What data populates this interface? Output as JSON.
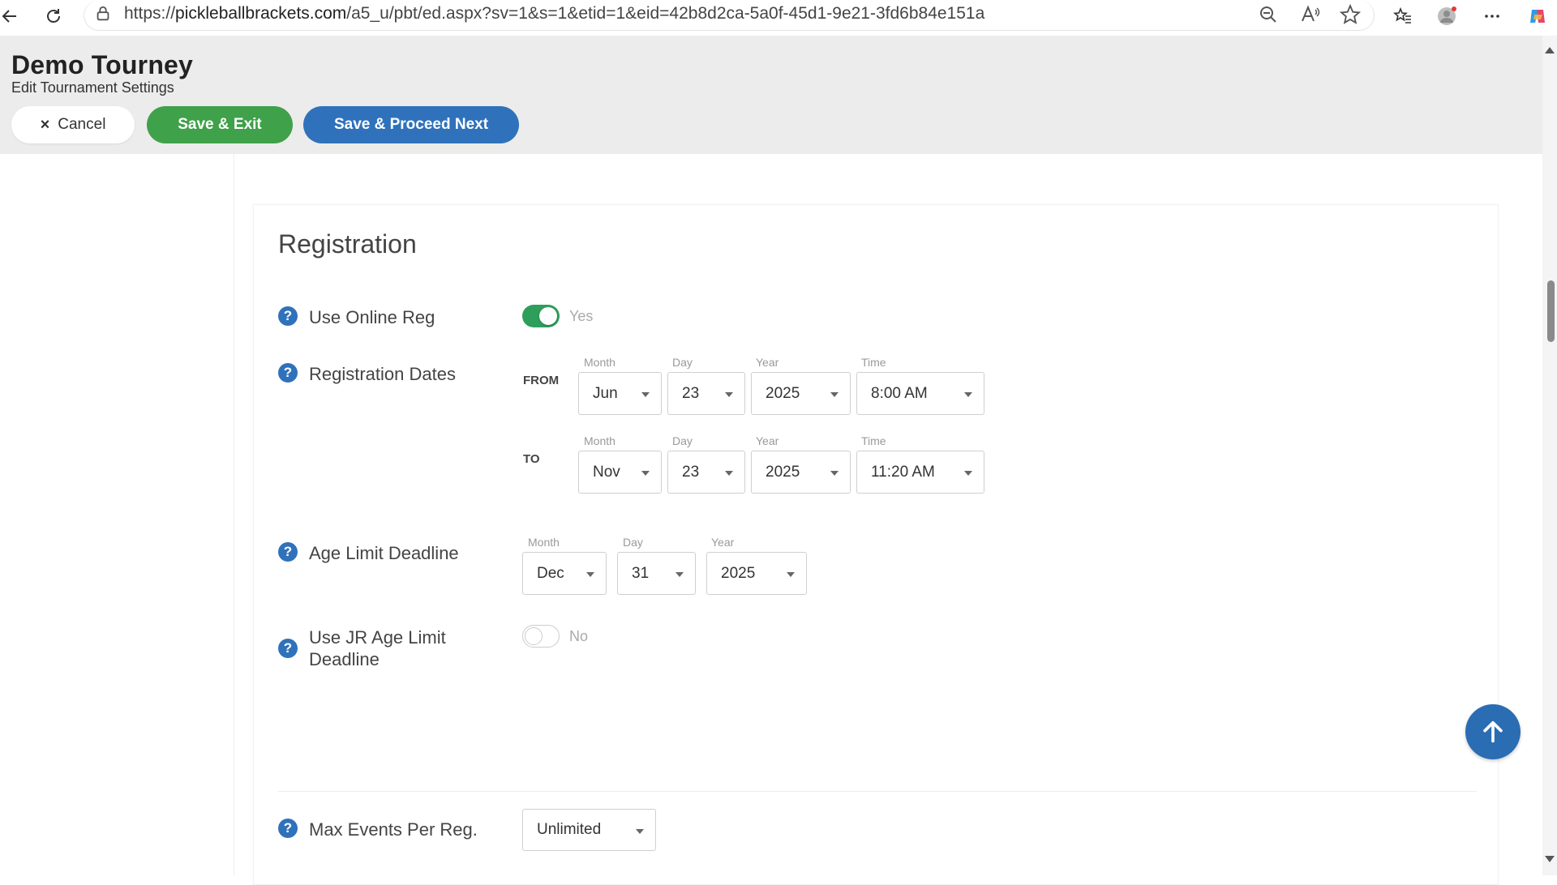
{
  "browser": {
    "url_prefix": "https://",
    "url_host": "pickleballbrackets.com",
    "url_path": "/a5_u/pbt/ed.aspx?sv=1&s=1&etid=1&eid=42b8d2ca-5a0f-45d1-9e21-3fd6b84e151a"
  },
  "header": {
    "title": "Demo Tourney",
    "subtitle": "Edit Tournament Settings",
    "cancel_label": "Cancel",
    "cancel_icon": "×",
    "save_exit_label": "Save & Exit",
    "save_next_label": "Save & Proceed Next",
    "colors": {
      "save_exit": "#3fa14a",
      "save_next": "#2f72bb"
    }
  },
  "section": {
    "title": "Registration"
  },
  "help_glyph": "?",
  "rows": {
    "online_reg": {
      "label": "Use Online Reg",
      "toggle_state": "Yes",
      "on": true
    },
    "reg_dates": {
      "label": "Registration Dates",
      "from_label": "FROM",
      "to_label": "TO",
      "captions": {
        "month": "Month",
        "day": "Day",
        "year": "Year",
        "time": "Time"
      },
      "from": {
        "month": "Jun",
        "day": "23",
        "year": "2025",
        "time": "8:00 AM"
      },
      "to": {
        "month": "Nov",
        "day": "23",
        "year": "2025",
        "time": "11:20 AM"
      }
    },
    "age_limit": {
      "label": "Age Limit Deadline",
      "captions": {
        "month": "Month",
        "day": "Day",
        "year": "Year"
      },
      "month": "Dec",
      "day": "31",
      "year": "2025"
    },
    "jr_age_limit": {
      "label_line1": "Use JR Age Limit",
      "label_line2": "Deadline",
      "toggle_state": "No",
      "on": false
    },
    "max_events": {
      "label": "Max Events Per Reg.",
      "value": "Unlimited"
    }
  },
  "icons": {
    "back": "back-arrow-icon",
    "refresh": "refresh-icon",
    "lock": "lock-icon",
    "zoom": "zoom-out-icon",
    "read_aloud": "read-aloud-icon",
    "favorite": "star-icon",
    "favorites_bar": "favorites-icon",
    "profile": "profile-avatar-icon",
    "more": "more-icon",
    "copilot": "copilot-icon",
    "scroll_top": "arrow-up-icon"
  }
}
